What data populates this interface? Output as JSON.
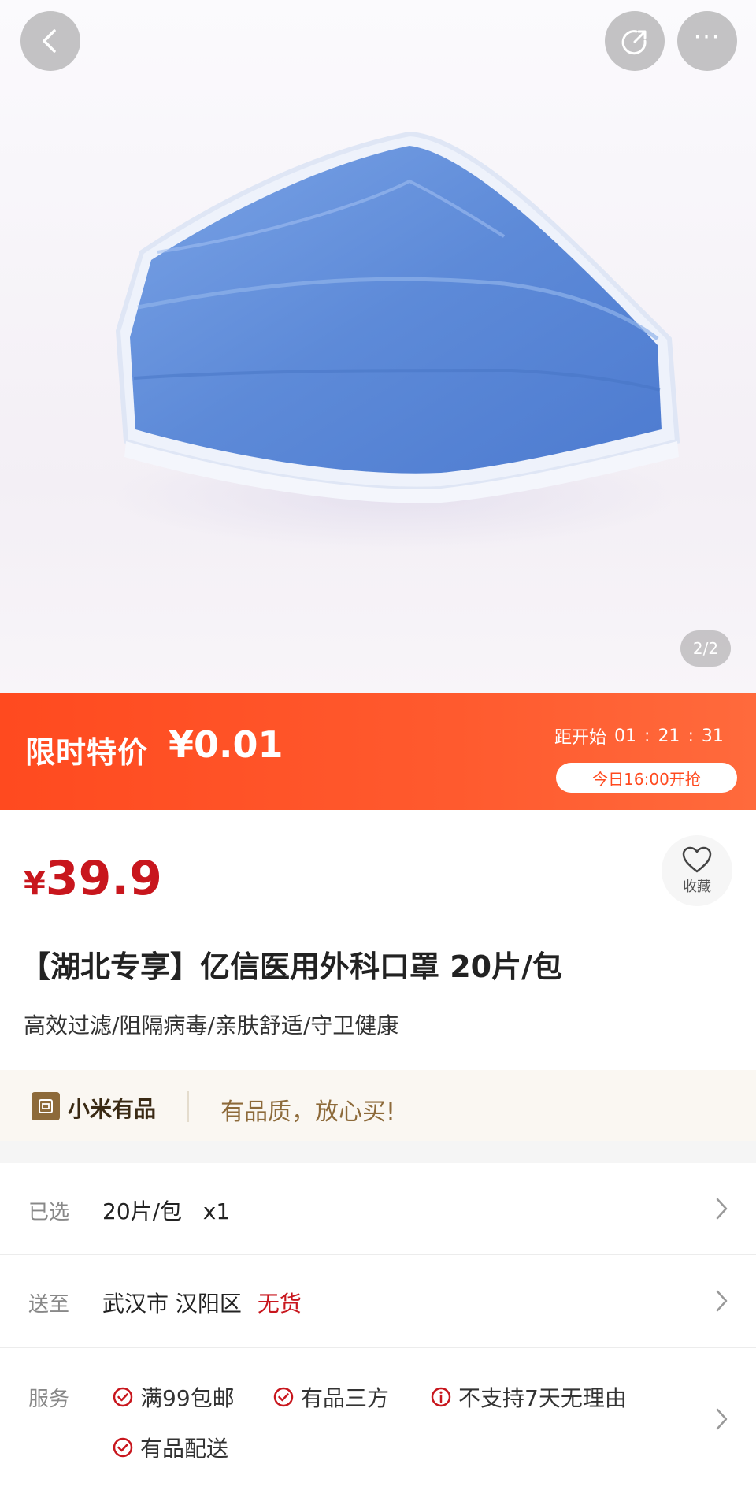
{
  "header": {
    "back_icon": "chevron-left-icon",
    "share_icon": "share-icon",
    "more_label": "···"
  },
  "gallery": {
    "pager": "2/2"
  },
  "flash_sale": {
    "label": "限时特价",
    "price": "¥0.01",
    "countdown_label": "距开始",
    "hours": "01",
    "minutes": "21",
    "seconds": "31",
    "start_time": "今日16:00开抢",
    "colors": {
      "start": "#ff4a1f",
      "end": "#ff6a3c"
    }
  },
  "product": {
    "price_symbol": "¥",
    "price_value": "39.9",
    "favorite_label": "收藏",
    "title": "【湖北专享】亿信医用外科口罩 20片/包",
    "subtitle": "高效过滤/阻隔病毒/亲肤舒适/守卫健康",
    "price_color": "#c8161d"
  },
  "brand": {
    "name": "小米有品",
    "slogan": "有品质，放心买!"
  },
  "selection": {
    "label": "已选",
    "value": "20片/包   x1"
  },
  "delivery": {
    "label": "送至",
    "value": "武汉市 汉阳区",
    "status": "无货"
  },
  "service": {
    "label": "服务",
    "items": [
      "满99包邮",
      "有品三方",
      "不支持7天无理由",
      "有品配送"
    ]
  }
}
